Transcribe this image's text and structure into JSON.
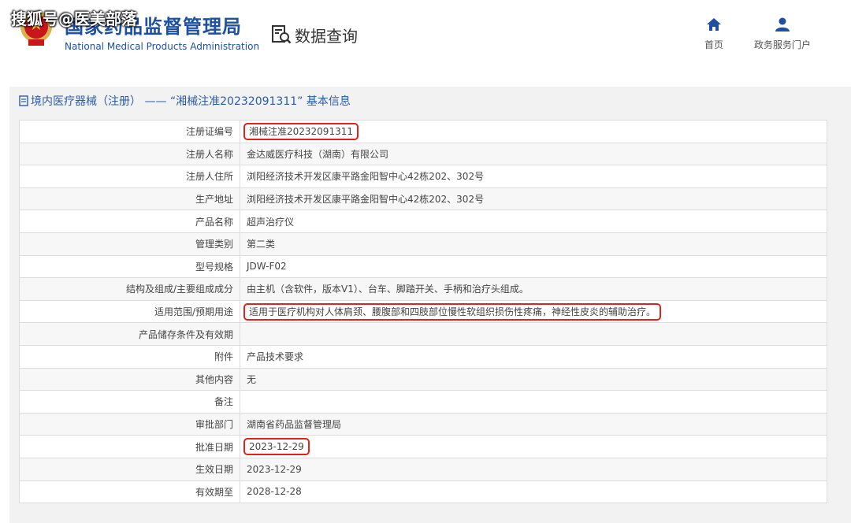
{
  "header": {
    "brand_cn": "国家药品监督管理局",
    "brand_en": "National Medical Products Administration",
    "watermark": "搜狐号@医美部落",
    "query_label": "数据查询",
    "nav": {
      "home": "首页",
      "portal": "政务服务门户"
    }
  },
  "panel": {
    "title": "境内医疗器械（注册） —— “湘械注准20232091311” 基本信息"
  },
  "rows": [
    {
      "label": "注册证编号",
      "value": "湘械注准20232091311"
    },
    {
      "label": "注册人名称",
      "value": "金达威医疗科技（湖南）有限公司"
    },
    {
      "label": "注册人住所",
      "value": "浏阳经济技术开发区康平路金阳智中心42栋202、302号"
    },
    {
      "label": "生产地址",
      "value": "浏阳经济技术开发区康平路金阳智中心42栋202、302号"
    },
    {
      "label": "产品名称",
      "value": "超声治疗仪"
    },
    {
      "label": "管理类别",
      "value": "第二类"
    },
    {
      "label": "型号规格",
      "value": "JDW-F02"
    },
    {
      "label": "结构及组成/主要组成成分",
      "value": "由主机（含软件，版本V1）、台车、脚踏开关、手柄和治疗头组成。"
    },
    {
      "label": "适用范围/预期用途",
      "value": "适用于医疗机构对人体肩颈、腰腹部和四肢部位慢性软组织损伤性疼痛，神经性皮炎的辅助治疗。"
    },
    {
      "label": "产品储存条件及有效期",
      "value": ""
    },
    {
      "label": "附件",
      "value": "产品技术要求"
    },
    {
      "label": "其他内容",
      "value": "无"
    },
    {
      "label": "备注",
      "value": ""
    },
    {
      "label": "审批部门",
      "value": "湖南省药品监督管理局"
    },
    {
      "label": "批准日期",
      "value": "2023-12-29"
    },
    {
      "label": "生效日期",
      "value": "2023-12-29"
    },
    {
      "label": "有效期至",
      "value": "2028-12-28"
    }
  ],
  "colors": {
    "brand": "#1d4fa3",
    "highlight": "#e0231b",
    "panel_bg": "#f2f2f2"
  }
}
